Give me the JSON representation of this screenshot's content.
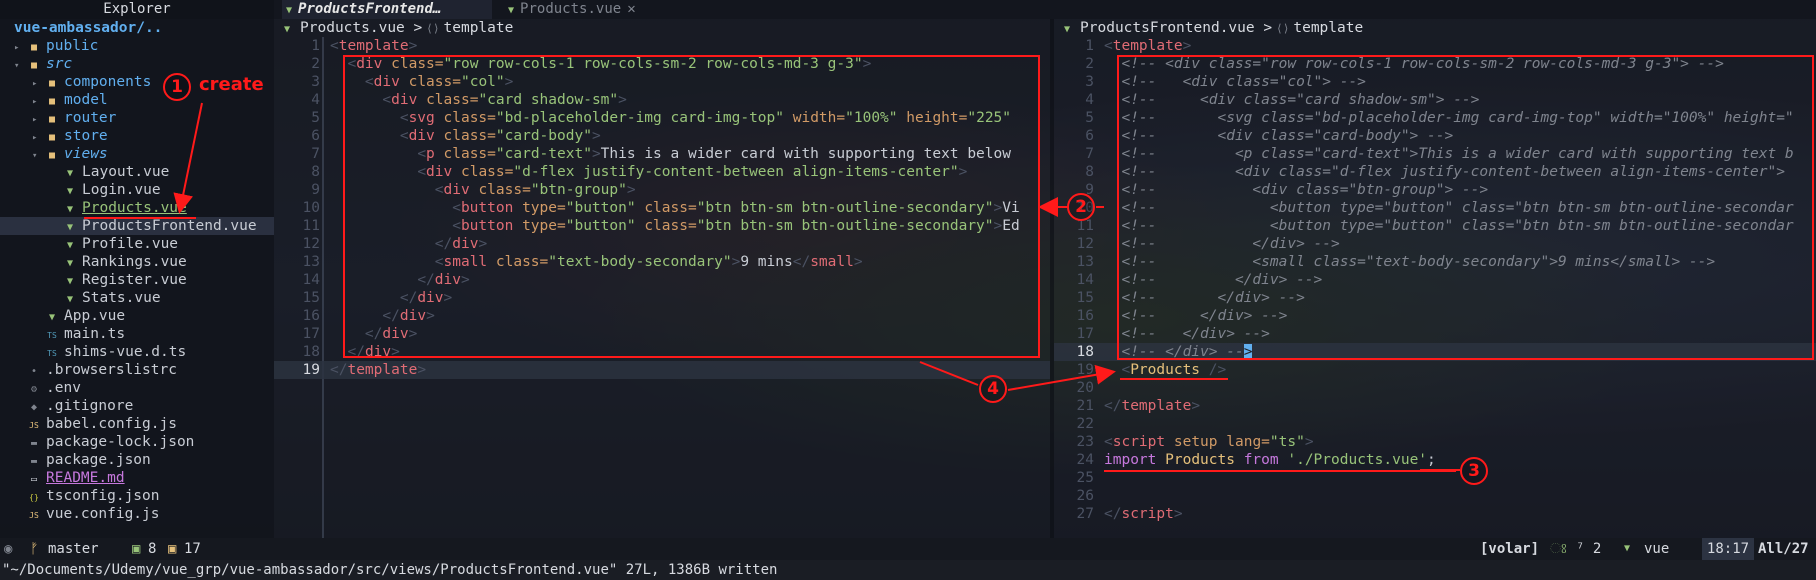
{
  "sidebar": {
    "title": "Explorer",
    "root": "vue-ambassador/..",
    "items": [
      {
        "label": "public",
        "kind": "dir"
      },
      {
        "label": "src",
        "kind": "dir-open"
      },
      {
        "label": "components",
        "kind": "dir"
      },
      {
        "label": "model",
        "kind": "dir"
      },
      {
        "label": "router",
        "kind": "dir"
      },
      {
        "label": "store",
        "kind": "dir"
      },
      {
        "label": "views",
        "kind": "dir-open"
      },
      {
        "label": "Layout.vue",
        "kind": "vue"
      },
      {
        "label": "Login.vue",
        "kind": "vue"
      },
      {
        "label": "Products.vue",
        "kind": "vue"
      },
      {
        "label": "ProductsFrontend.vue",
        "kind": "vue"
      },
      {
        "label": "Profile.vue",
        "kind": "vue"
      },
      {
        "label": "Rankings.vue",
        "kind": "vue"
      },
      {
        "label": "Register.vue",
        "kind": "vue"
      },
      {
        "label": "Stats.vue",
        "kind": "vue"
      },
      {
        "label": "App.vue",
        "kind": "vue"
      },
      {
        "label": "main.ts",
        "kind": "ts"
      },
      {
        "label": "shims-vue.d.ts",
        "kind": "ts"
      },
      {
        "label": ".browserslistrc",
        "kind": "file"
      },
      {
        "label": ".env",
        "kind": "file"
      },
      {
        "label": ".gitignore",
        "kind": "file"
      },
      {
        "label": "babel.config.js",
        "kind": "js"
      },
      {
        "label": "package-lock.json",
        "kind": "json"
      },
      {
        "label": "package.json",
        "kind": "json"
      },
      {
        "label": "README.md",
        "kind": "md"
      },
      {
        "label": "tsconfig.json",
        "kind": "json"
      },
      {
        "label": "vue.config.js",
        "kind": "js"
      }
    ]
  },
  "tabs": [
    {
      "label": "ProductsFrontend…",
      "close": ""
    },
    {
      "label": "Products.vue",
      "close": "✕"
    }
  ],
  "left_pane": {
    "breadcrumb_file": "Products.vue",
    "breadcrumb_sep": ">",
    "breadcrumb_section": "template",
    "line_numbers": [
      "1",
      "2",
      "3",
      "4",
      "5",
      "6",
      "7",
      "8",
      "9",
      "10",
      "11",
      "12",
      "13",
      "14",
      "15",
      "16",
      "17",
      "18",
      "19"
    ]
  },
  "right_pane": {
    "breadcrumb_file": "ProductsFrontend.vue",
    "breadcrumb_sep": ">",
    "breadcrumb_section": "template",
    "line_numbers": [
      "1",
      "2",
      "3",
      "4",
      "5",
      "6",
      "7",
      "8",
      "9",
      "10",
      "11",
      "12",
      "13",
      "14",
      "15",
      "16",
      "17",
      "18",
      "19",
      "20",
      "21",
      "22",
      "23",
      "24",
      "25",
      "26",
      "27"
    ]
  },
  "statusbar": {
    "mode_icon": "◉",
    "branch_icon": "ᚠ",
    "branch": "master",
    "stat1_icon": "▣",
    "stat1": "8",
    "stat2_icon": "▣",
    "stat2": "17",
    "lsp": "[volar]",
    "lsp_icon": "ଃ",
    "diag": "⁷ 2",
    "filetype_icon": "▼",
    "filetype": "vue",
    "position": "18:17",
    "scroll": "All/27"
  },
  "cmdline": "\"~/Documents/Udemy/vue_grp/vue-ambassador/src/views/ProductsFrontend.vue\" 27L, 1386B written",
  "annotations": {
    "a1": "1",
    "a1_text": "create",
    "a2": "2",
    "a3": "3",
    "a4": "4"
  },
  "colors": {
    "accent_red": "#ff1a1a",
    "vue_green": "#98c379",
    "dir_blue": "#61afef"
  }
}
